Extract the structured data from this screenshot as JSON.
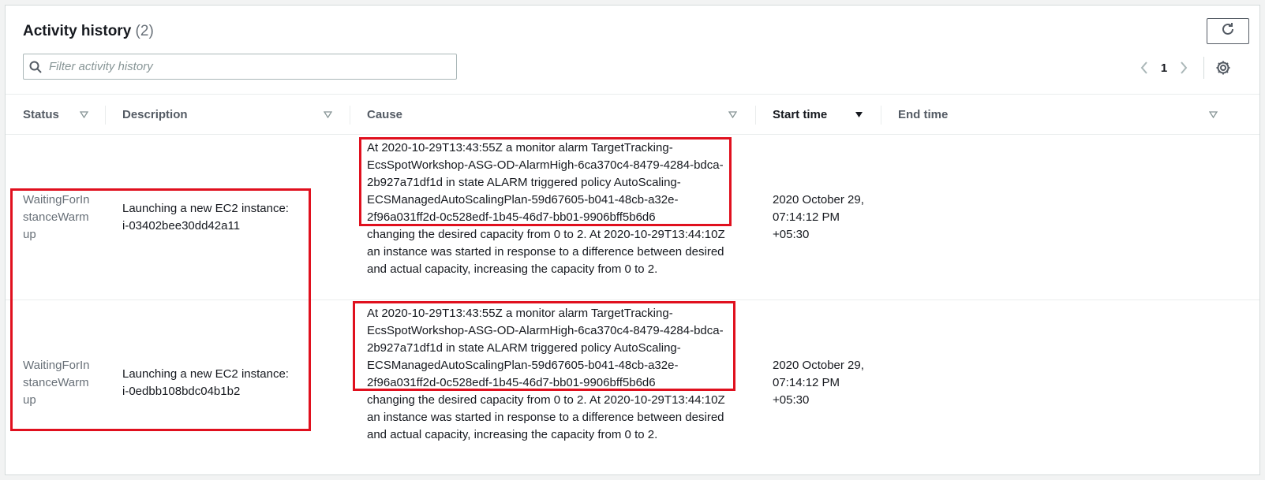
{
  "header": {
    "title": "Activity history",
    "count": "(2)"
  },
  "search": {
    "placeholder": "Filter activity history",
    "value": ""
  },
  "pagination": {
    "current_page": "1"
  },
  "columns": [
    {
      "label": "Status"
    },
    {
      "label": "Description"
    },
    {
      "label": "Cause"
    },
    {
      "label": "Start time"
    },
    {
      "label": "End time"
    }
  ],
  "rows": [
    {
      "status": "WaitingForInstanceWarmup",
      "description_line1": "Launching a new EC2 instance:",
      "description_line2": "i-03402bee30dd42a11",
      "cause_highlighted": "At 2020-10-29T13:43:55Z a monitor alarm TargetTracking-EcsSpotWorkshop-ASG-OD-AlarmHigh-6ca370c4-8479-4284-bdca-2b927a71df1d in state ALARM triggered policy AutoScaling-ECSManagedAutoScalingPlan-59d67605-b041-48cb-a32e-2f96a031ff2d-0c528edf-1b45-46d7-bb01-9906bff5b6d6",
      "cause_rest": "changing the desired capacity from 0 to 2. At 2020-10-29T13:44:10Z an instance was started in response to a difference between desired and actual capacity, increasing the capacity from 0 to 2.",
      "start_time": "2020 October 29, 07:14:12 PM +05:30",
      "end_time": ""
    },
    {
      "status": "WaitingForInstanceWarmup",
      "description_line1": "Launching a new EC2 instance:",
      "description_line2": "i-0edbb108bdc04b1b2",
      "cause_highlighted": "At 2020-10-29T13:43:55Z a monitor alarm TargetTracking-EcsSpotWorkshop-ASG-OD-AlarmHigh-6ca370c4-8479-4284-bdca-2b927a71df1d in state ALARM triggered policy AutoScaling-ECSManagedAutoScalingPlan-59d67605-b041-48cb-a32e-2f96a031ff2d-0c528edf-1b45-46d7-bb01-9906bff5b6d6",
      "cause_rest": "changing the desired capacity from 0 to 2. At 2020-10-29T13:44:10Z an instance was started in response to a difference between desired and actual capacity, increasing the capacity from 0 to 2.",
      "start_time": "2020 October 29, 07:14:12 PM +05:30",
      "end_time": ""
    }
  ],
  "icons": {
    "refresh": "refresh-icon",
    "search": "search-icon",
    "prev": "chevron-left-icon",
    "next": "chevron-right-icon",
    "settings": "gear-icon",
    "sort_filter": "caret-down-icon"
  },
  "colors": {
    "highlight_box": "#e0101e",
    "status_text": "#687078"
  }
}
